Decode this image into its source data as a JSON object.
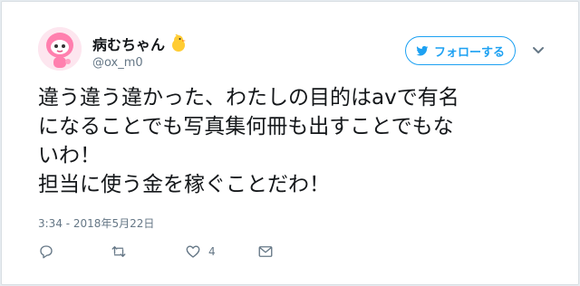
{
  "user": {
    "display_name": "病むちゃん",
    "badge_icon": "chick-emoji",
    "handle": "@ox_m0",
    "avatar_icon": "pink-mascot-avatar"
  },
  "header": {
    "follow_label": "フォローする",
    "menu_icon": "chevron-down-icon"
  },
  "tweet": {
    "text": "違う違う違かった、わたしの目的はavで有名\nになることでも写真集何冊も出すことでもな\nいわ！\n担当に使う金を稼ぐことだわ！",
    "timestamp": "3:34 - 2018年5月22日"
  },
  "actions": {
    "reply_icon": "reply-icon",
    "retweet_icon": "retweet-icon",
    "like_icon": "heart-icon",
    "like_count": "4",
    "message_icon": "envelope-icon"
  },
  "colors": {
    "accent": "#1da1f2",
    "text": "#14171a",
    "muted": "#657786"
  }
}
